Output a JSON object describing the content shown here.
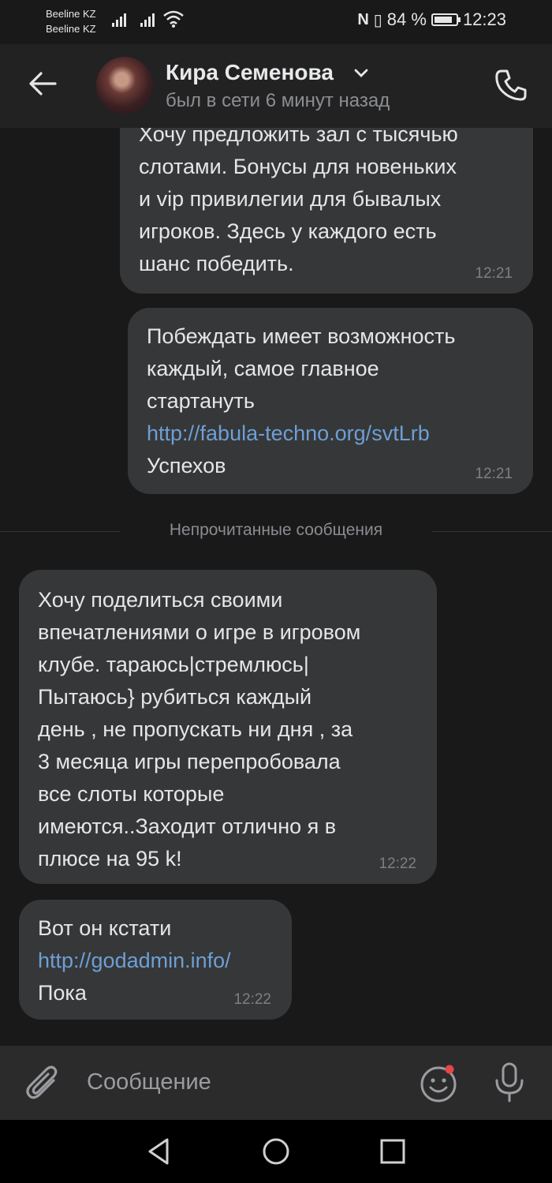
{
  "status_bar": {
    "carrier1": "Beeline KZ",
    "carrier2": "Beeline KZ",
    "battery": "84 %",
    "time": "12:23"
  },
  "header": {
    "name": "Кира Семенова",
    "status": "был в сети 6 минут назад"
  },
  "messages": [
    {
      "text": "Хочу предложить зал с тысячью\nслотами. Бонусы для новеньких\nи vip привилегии для бывалых\nигроков. Здесь у каждого есть\nшанс победить.",
      "time": "12:21"
    },
    {
      "text": "Побеждать имеет возможность\nкаждый, самое главное\nстартануть",
      "link": "http://fabula-techno.org/svtLrb",
      "after": "Успехов",
      "time": "12:21"
    },
    {
      "text": "Хочу поделиться своими\nвпечатлениями о игре в игровом\nклубе. тараюсь|стремлюсь|\nПытаюсь} рубиться каждый\nдень , не пропускать ни дня , за\n3 месяца игры перепробовала\nвсе слоты которые\nимеются..Заходит отлично я в\nплюсе на 95 k!",
      "time": "12:22"
    },
    {
      "text": "Вот он кстати",
      "link": "http://godadmin.info/",
      "after": "Пока",
      "time": "12:22"
    }
  ],
  "divider_label": "Непрочитанные сообщения",
  "composer": {
    "placeholder": "Сообщение"
  },
  "colors": {
    "background": "#19191a",
    "bubble": "#363738",
    "link": "#6d9fd6",
    "notification_dot": "#e64646"
  }
}
